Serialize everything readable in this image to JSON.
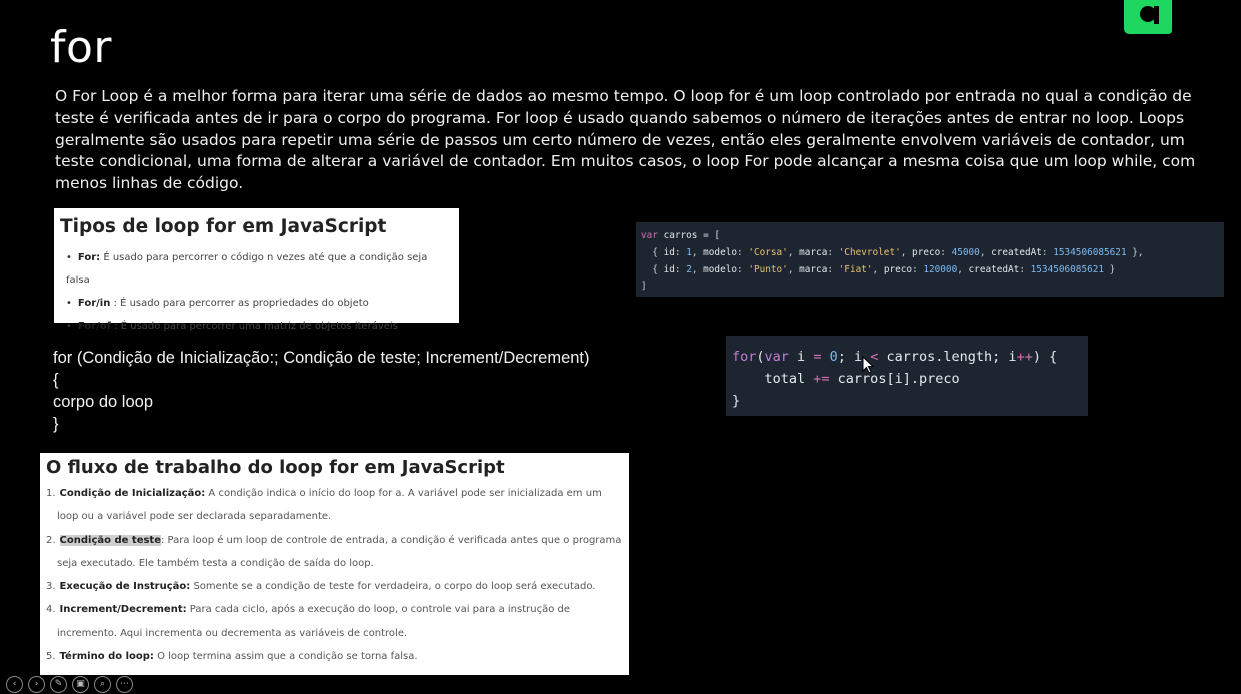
{
  "slide": {
    "title": "for",
    "intro": "O For Loop é a melhor forma para iterar uma série de dados ao mesmo tempo. O loop for é um loop controlado por entrada no qual a condição de teste é verificada antes de ir para o corpo do programa. For loop é usado quando sabemos o número de iterações antes de entrar no loop. Loops geralmente são usados para repetir uma série de passos um certo número de vezes, então eles geralmente envolvem variáveis de contador, um teste condicional, uma forma de alterar a variável de contador. Em muitos casos, o loop For pode alcançar a mesma coisa que um loop while, com menos linhas de código."
  },
  "types": {
    "title": "Tipos de loop for em JavaScript",
    "items": [
      {
        "term": "For:",
        "desc": " É usado para percorrer o código n vezes até que a condição seja falsa"
      },
      {
        "term": "For/in",
        "desc": " : É usado para percorrer as propriedades do objeto"
      },
      {
        "term": "For/of",
        "desc": " : É usado para percorrer uma matriz de objetos iteráveis"
      }
    ]
  },
  "code1": {
    "var_kw": "var",
    "var_name": " carros = [",
    "rows": [
      {
        "id": "1",
        "modelo": "'Corsa'",
        "marca": "'Chevrolet'",
        "preco": "45000",
        "createdAt": "1534506085621",
        "end": " },"
      },
      {
        "id": "2",
        "modelo": "'Punto'",
        "marca": "'Fiat'",
        "preco": "120000",
        "createdAt": "1534506085621",
        "end": " }"
      }
    ],
    "close": "]"
  },
  "code2": {
    "line1_a": "for",
    "line1_b": "(",
    "line1_c": "var",
    "line1_d": " i ",
    "line1_e": "=",
    "line1_f": " ",
    "line1_g": "0",
    "line1_h": "; i ",
    "line1_i": "<",
    "line1_j": " carros.length; i",
    "line1_k": "++",
    "line1_l": ") {",
    "line2_a": "    total ",
    "line2_b": "+=",
    "line2_c": " carros[i].preco",
    "line3": "}"
  },
  "syntax": {
    "line1": "for (Condição de Inicialização:; Condição de teste; Increment/Decrement)",
    "line2": "{",
    "line3": "corpo do loop",
    "line4": "}"
  },
  "flow": {
    "title": "O fluxo de trabalho do loop for em JavaScript",
    "items": [
      {
        "num": "1.",
        "term": "Condição de Inicialização:",
        "desc": "  A condição indica o início do loop for a. A variável pode ser inicializada em um loop ou a variável pode ser declarada separadamente."
      },
      {
        "num": "2.",
        "term": "Condição de teste",
        "desc": ": Para loop é um loop de controle de entrada, a condição é verificada antes que o programa seja executado. Ele também testa a condição de saída do loop."
      },
      {
        "num": "3.",
        "term": "Execução de Instrução:",
        "desc": " Somente se a condição de teste for verdadeira, o corpo do loop será executado."
      },
      {
        "num": "4.",
        "term": "Increment/Decrement:",
        "desc": " Para cada ciclo, após a execução do loop, o controle vai para a instrução de incremento. Aqui incrementa ou decrementa as variáveis de controle."
      },
      {
        "num": "5.",
        "term": "Término do loop:",
        "desc": "  O loop termina assim que a condição se torna falsa."
      }
    ]
  },
  "controls": {
    "icons": [
      "chevron-left-icon",
      "chevron-right-icon",
      "pen-icon",
      "slides-icon",
      "zoom-icon",
      "more-icon"
    ],
    "glyphs": [
      "‹",
      "›",
      "✎",
      "▣",
      "⌕",
      "⋯"
    ]
  },
  "colors": {
    "background": "#000000",
    "logo_green": "#1ed760",
    "code_bg": "#1c2530"
  }
}
